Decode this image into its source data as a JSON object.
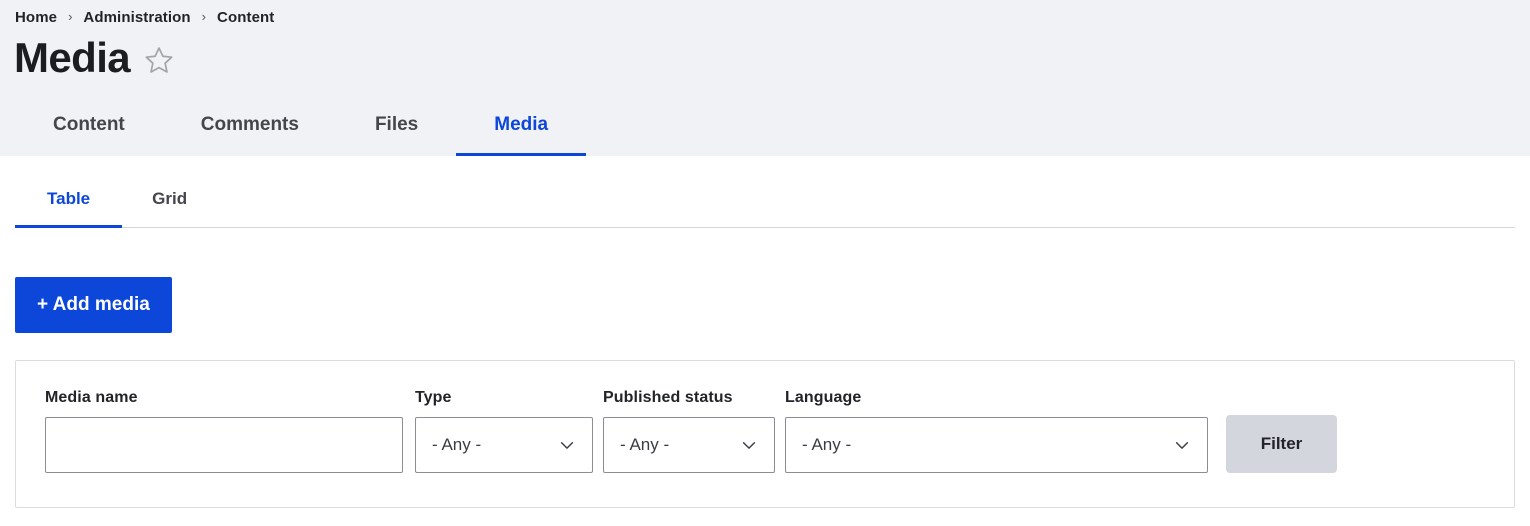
{
  "breadcrumb": {
    "separator": "›",
    "items": [
      {
        "label": "Home"
      },
      {
        "label": "Administration"
      },
      {
        "label": "Content"
      }
    ]
  },
  "header": {
    "title": "Media",
    "star_icon": "star-outline-icon"
  },
  "primary_tabs": [
    {
      "label": "Content",
      "active": false
    },
    {
      "label": "Comments",
      "active": false
    },
    {
      "label": "Files",
      "active": false
    },
    {
      "label": "Media",
      "active": true
    }
  ],
  "secondary_tabs": [
    {
      "label": "Table",
      "active": true
    },
    {
      "label": "Grid",
      "active": false
    }
  ],
  "actions": {
    "add_media_label": "+ Add media"
  },
  "filters": {
    "media_name": {
      "label": "Media name",
      "value": "",
      "placeholder": ""
    },
    "type": {
      "label": "Type",
      "value": "- Any -"
    },
    "published_status": {
      "label": "Published status",
      "value": "- Any -"
    },
    "language": {
      "label": "Language",
      "value": "- Any -"
    },
    "filter_button_label": "Filter"
  },
  "colors": {
    "accent": "#0d47d9",
    "header_bg": "#f1f2f6",
    "button_grey": "#d3d6dd",
    "border": "#8b8d93",
    "panel_border": "#dcdcde"
  }
}
